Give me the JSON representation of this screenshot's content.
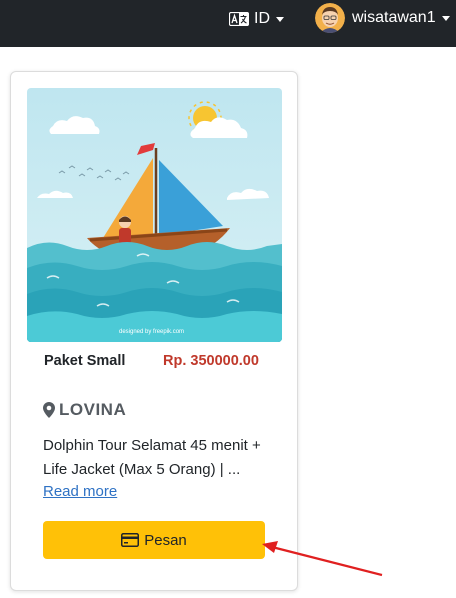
{
  "navbar": {
    "language": "ID",
    "username": "wisatawan1",
    "background": "#212529"
  },
  "card": {
    "image_credit": "designed by freepik.com",
    "package_name": "Paket Small",
    "price": "Rp. 350000.00",
    "location": "LOVINA",
    "description": "Dolphin Tour Selamat 45 menit + Life Jacket (Max 5 Orang) | ...",
    "read_more": "Read more",
    "order_button": "Pesan",
    "price_color": "#c0392b",
    "button_color": "#ffc107"
  },
  "annotation": {
    "arrow_color": "#e02020"
  },
  "icons": {
    "language": "translate-icon",
    "location": "map-pin-icon",
    "order": "credit-card-icon"
  }
}
